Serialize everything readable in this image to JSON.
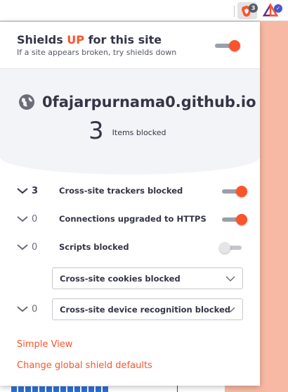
{
  "toolbar": {
    "shields_badge": "3",
    "rewards_badge": "✓"
  },
  "header": {
    "title_prefix": "Shields ",
    "title_status": "UP",
    "title_suffix": " for this site",
    "subtitle": "If a site appears broken, try shields down",
    "shields_enabled": true
  },
  "stats": {
    "site": "0fajarpurnama0.github.io",
    "blocked_count": "3",
    "blocked_label": "Items blocked"
  },
  "controls": [
    {
      "count": "3",
      "label": "Cross-site trackers blocked",
      "enabled": true
    },
    {
      "count": "0",
      "label": "Connections upgraded to HTTPS",
      "enabled": true
    },
    {
      "count": "0",
      "label": "Scripts blocked",
      "enabled": false
    }
  ],
  "cookies_select": {
    "value": "Cross-site cookies blocked"
  },
  "fingerprint": {
    "count": "0",
    "value": "Cross-site device recognition blocked"
  },
  "links": {
    "simple_view": "Simple View",
    "global_defaults": "Change global shield defaults"
  },
  "colors": {
    "accent": "#fb542b",
    "text": "#343546"
  }
}
